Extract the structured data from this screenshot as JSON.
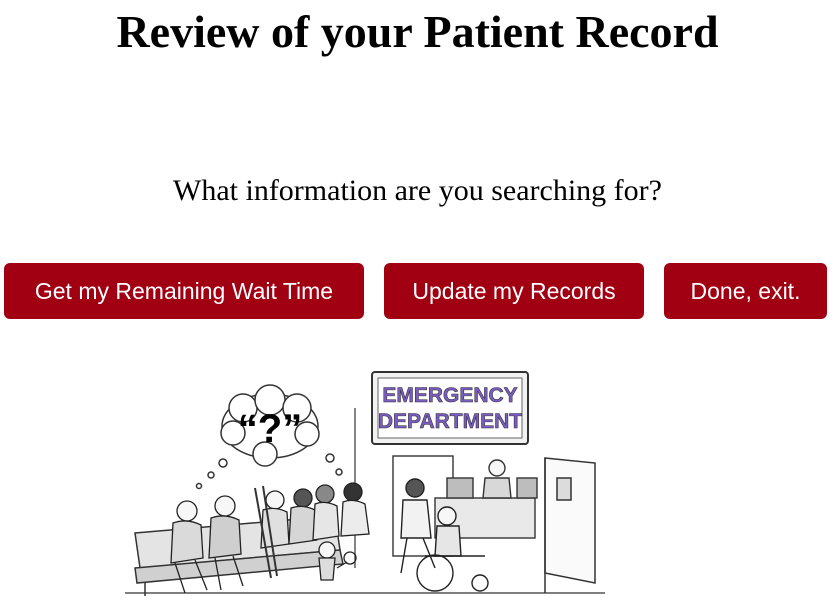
{
  "header": {
    "title": "Review of your Patient Record"
  },
  "main": {
    "question": "What information are you searching for?",
    "buttons": {
      "wait_time_label": "Get my Remaining Wait Time",
      "update_label": "Update my Records",
      "done_label": "Done, exit."
    },
    "illustration": {
      "sign_line1": "EMERGENCY",
      "sign_line2": "DEPARTMENT",
      "thought_text": "“?”"
    }
  },
  "colors": {
    "button_bg": "#a00011",
    "button_text": "#ffffff",
    "sign_text": "#7b5cc4"
  }
}
